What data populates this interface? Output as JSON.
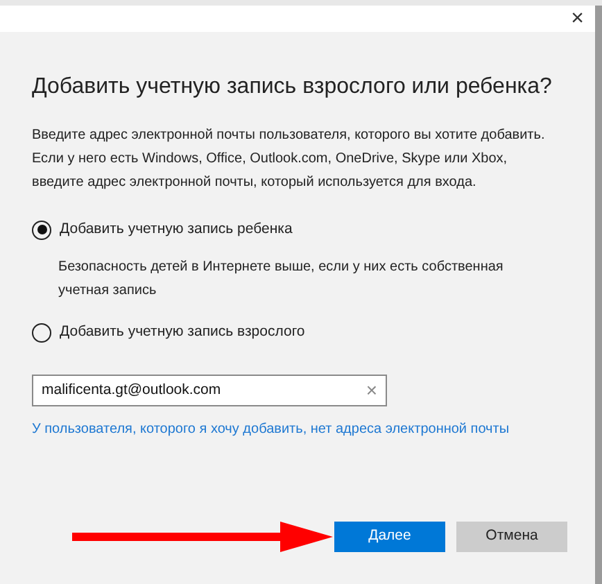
{
  "title": "Добавить учетную запись взрослого или ребенка?",
  "intro": "Введите адрес электронной почты пользователя, которого вы хотите добавить. Если у него есть Windows, Office, Outlook.com, OneDrive, Skype или Xbox, введите адрес электронной почты, который используется для входа.",
  "options": [
    {
      "label": "Добавить учетную запись ребенка",
      "selected": true,
      "description": "Безопасность детей в Интернете выше, если у них есть собственная учетная запись"
    },
    {
      "label": "Добавить учетную запись взрослого",
      "selected": false
    }
  ],
  "email": {
    "value": "malificenta.gt@outlook.com",
    "clear": "×"
  },
  "close": "×",
  "no_email_link": "У пользователя, которого я хочу добавить, нет адреса электронной почты",
  "buttons": [
    {
      "label": "Далее",
      "kind": "primary"
    },
    {
      "label": "Отмена",
      "kind": "secondary"
    }
  ]
}
